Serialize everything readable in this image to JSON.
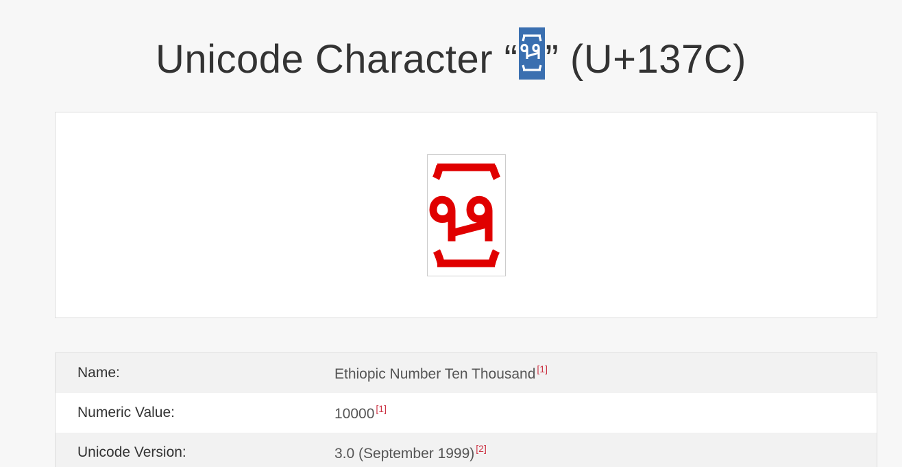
{
  "header": {
    "title_prefix": "Unicode Character “",
    "title_suffix": "” (U+137C)",
    "glyph_icon": "ethiopic-number-ten-thousand-glyph"
  },
  "glyph_preview": {
    "icon": "ethiopic-number-ten-thousand-glyph",
    "color": "#e00000"
  },
  "properties": [
    {
      "label": "Name:",
      "value": "Ethiopic Number Ten Thousand",
      "ref": "[1]"
    },
    {
      "label": "Numeric Value:",
      "value": "10000",
      "ref": "[1]"
    },
    {
      "label": "Unicode Version:",
      "value": "3.0 (September 1999)",
      "ref": "[2]"
    }
  ],
  "colors": {
    "background": "#f7f7f7",
    "glyph_red": "#e00000",
    "highlight_blue": "#3a6fb0",
    "ref_red": "#cc3344"
  }
}
